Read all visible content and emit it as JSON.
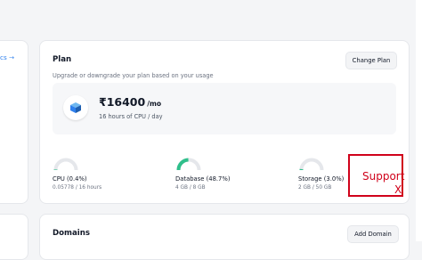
{
  "left_panel": {
    "link_label": "cs →"
  },
  "plan": {
    "title": "Plan",
    "change_button": "Change Plan",
    "subtitle": "Upgrade or downgrade your plan based on your usage",
    "price": "₹16400",
    "price_unit": "/mo",
    "price_detail": "16 hours of CPU / day"
  },
  "usage": [
    {
      "label": "CPU (0.4%)",
      "detail": "0.05778 / 16 hours",
      "fraction": 0.004
    },
    {
      "label": "Database (48.7%)",
      "detail": "4 GB / 8 GB",
      "fraction": 0.487
    },
    {
      "label": "Storage (3.0%)",
      "detail": "2 GB / 50 GB",
      "fraction": 0.03
    }
  ],
  "support": {
    "label": "Support",
    "close": "X"
  },
  "domains": {
    "title": "Domains",
    "add_button": "Add Domain"
  },
  "colors": {
    "gauge_fill": "#2fbf8b",
    "gauge_track": "#e5e7eb",
    "link": "#2f80ed",
    "support": "#d0021b"
  },
  "icons": {
    "plan": "cube-icon",
    "support_close": "close-icon"
  }
}
